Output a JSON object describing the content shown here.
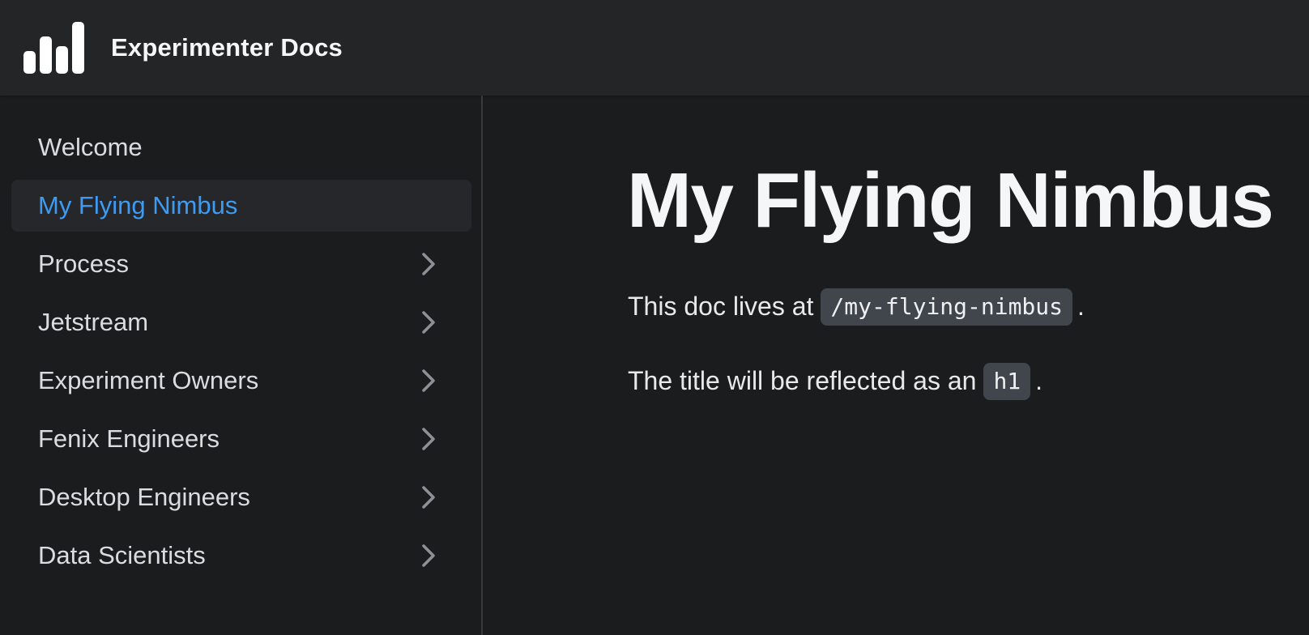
{
  "navbar": {
    "brand": "Experimenter Docs",
    "logo_icon": "bar-chart-logo-icon"
  },
  "sidebar": {
    "items": [
      {
        "label": "Welcome",
        "active": false,
        "expandable": false
      },
      {
        "label": "My Flying Nimbus",
        "active": true,
        "expandable": false
      },
      {
        "label": "Process",
        "active": false,
        "expandable": true
      },
      {
        "label": "Jetstream",
        "active": false,
        "expandable": true
      },
      {
        "label": "Experiment Owners",
        "active": false,
        "expandable": true
      },
      {
        "label": "Fenix Engineers",
        "active": false,
        "expandable": true
      },
      {
        "label": "Desktop Engineers",
        "active": false,
        "expandable": true
      },
      {
        "label": "Data Scientists",
        "active": false,
        "expandable": true
      }
    ],
    "chevron_icon": "chevron-right-icon"
  },
  "main": {
    "title": "My Flying Nimbus",
    "paragraphs": [
      {
        "before": "This doc lives at",
        "code": "/my-flying-nimbus",
        "after": "."
      },
      {
        "before": "The title will be reflected as an",
        "code": "h1",
        "after": "."
      }
    ]
  },
  "colors": {
    "background": "#1b1c1e",
    "navbar": "#242526",
    "accent": "#3d9bf4",
    "code_bg": "#41454c"
  }
}
